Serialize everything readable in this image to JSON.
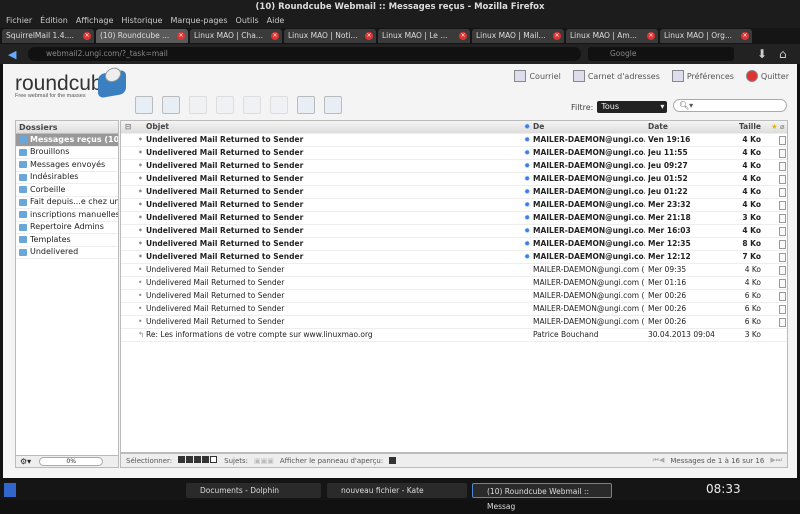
{
  "window": {
    "title": "(10) Roundcube Webmail :: Messages reçus - Mozilla Firefox"
  },
  "menu": [
    "Fichier",
    "Édition",
    "Affichage",
    "Historique",
    "Marque-pages",
    "Outils",
    "Aide"
  ],
  "tabs": [
    {
      "label": "SquirrelMail 1.4...."
    },
    {
      "label": "(10) Roundcube ...",
      "active": true
    },
    {
      "label": "Linux MAO | Cha..."
    },
    {
      "label": "Linux MAO | Noti..."
    },
    {
      "label": "Linux MAO | Le ..."
    },
    {
      "label": "Linux MAO | Mail..."
    },
    {
      "label": "Linux MAO | Am..."
    },
    {
      "label": "Linux MAO | Org..."
    }
  ],
  "nav": {
    "url": "webmail2.ungi.com/?_task=mail",
    "search_placeholder": "Google"
  },
  "app": {
    "logo": "roundcube",
    "tagline": "Free webmail for the masses",
    "topnav": [
      "Courriel",
      "Carnet d'adresses",
      "Préférences",
      "Quitter"
    ],
    "toolbar_icons": [
      "refresh-icon",
      "compose-icon",
      "reply-icon",
      "reply-all-icon",
      "forward-icon",
      "delete-icon",
      "mark-icon",
      "more-icon"
    ],
    "filter_label": "Filtre:",
    "filter_value": "Tous"
  },
  "folders": {
    "header": "Dossiers",
    "items": [
      "Messages reçus (10)",
      "Brouillons",
      "Messages envoyés",
      "Indésirables",
      "Corbeille",
      "Fait depuis...e chez ung",
      "inscriptions manuelles",
      "Repertoire Admins",
      "Templates",
      "Undelivered"
    ],
    "quota": "0%"
  },
  "list": {
    "columns": {
      "subject": "Objet",
      "from": "De",
      "date": "Date",
      "size": "Taille"
    },
    "rows": [
      {
        "subject": "Undelivered Mail Returned to Sender",
        "from": "MAILER-DAEMON@ungi.co...",
        "date": "Ven 19:16",
        "size": "4 Ko",
        "unread": true
      },
      {
        "subject": "Undelivered Mail Returned to Sender",
        "from": "MAILER-DAEMON@ungi.co...",
        "date": "Jeu 11:55",
        "size": "4 Ko",
        "unread": true
      },
      {
        "subject": "Undelivered Mail Returned to Sender",
        "from": "MAILER-DAEMON@ungi.co...",
        "date": "Jeu 09:27",
        "size": "4 Ko",
        "unread": true
      },
      {
        "subject": "Undelivered Mail Returned to Sender",
        "from": "MAILER-DAEMON@ungi.co...",
        "date": "Jeu 01:52",
        "size": "4 Ko",
        "unread": true
      },
      {
        "subject": "Undelivered Mail Returned to Sender",
        "from": "MAILER-DAEMON@ungi.co...",
        "date": "Jeu 01:22",
        "size": "4 Ko",
        "unread": true
      },
      {
        "subject": "Undelivered Mail Returned to Sender",
        "from": "MAILER-DAEMON@ungi.co...",
        "date": "Mer 23:32",
        "size": "4 Ko",
        "unread": true
      },
      {
        "subject": "Undelivered Mail Returned to Sender",
        "from": "MAILER-DAEMON@ungi.co...",
        "date": "Mer 21:18",
        "size": "3 Ko",
        "unread": true
      },
      {
        "subject": "Undelivered Mail Returned to Sender",
        "from": "MAILER-DAEMON@ungi.co...",
        "date": "Mer 16:03",
        "size": "4 Ko",
        "unread": true
      },
      {
        "subject": "Undelivered Mail Returned to Sender",
        "from": "MAILER-DAEMON@ungi.co...",
        "date": "Mer 12:35",
        "size": "8 Ko",
        "unread": true
      },
      {
        "subject": "Undelivered Mail Returned to Sender",
        "from": "MAILER-DAEMON@ungi.co...",
        "date": "Mer 12:12",
        "size": "7 Ko",
        "unread": true
      },
      {
        "subject": "Undelivered Mail Returned to Sender",
        "from": "MAILER-DAEMON@ungi.com (...",
        "date": "Mer 09:35",
        "size": "4 Ko",
        "unread": false
      },
      {
        "subject": "Undelivered Mail Returned to Sender",
        "from": "MAILER-DAEMON@ungi.com (...",
        "date": "Mer 01:16",
        "size": "4 Ko",
        "unread": false
      },
      {
        "subject": "Undelivered Mail Returned to Sender",
        "from": "MAILER-DAEMON@ungi.com (...",
        "date": "Mer 00:26",
        "size": "6 Ko",
        "unread": false
      },
      {
        "subject": "Undelivered Mail Returned to Sender",
        "from": "MAILER-DAEMON@ungi.com (...",
        "date": "Mer 00:26",
        "size": "6 Ko",
        "unread": false
      },
      {
        "subject": "Undelivered Mail Returned to Sender",
        "from": "MAILER-DAEMON@ungi.com (...",
        "date": "Mer 00:26",
        "size": "6 Ko",
        "unread": false
      },
      {
        "subject": "Re: Les informations de votre compte sur www.linuxmao.org",
        "from": "Patrice Bouchand",
        "date": "30.04.2013 09:04",
        "size": "3 Ko",
        "unread": false,
        "replied": true
      }
    ],
    "footer": {
      "select": "Sélectionner:",
      "threads": "Sujets:",
      "preview": "Afficher le panneau d'aperçu:",
      "count": "Messages de 1 à 16 sur 16"
    }
  },
  "taskbar": {
    "tasks": [
      "Documents - Dolphin",
      "nouveau fichier - Kate",
      "(10) Roundcube Webmail :: Messag"
    ],
    "clock": "08:33"
  }
}
